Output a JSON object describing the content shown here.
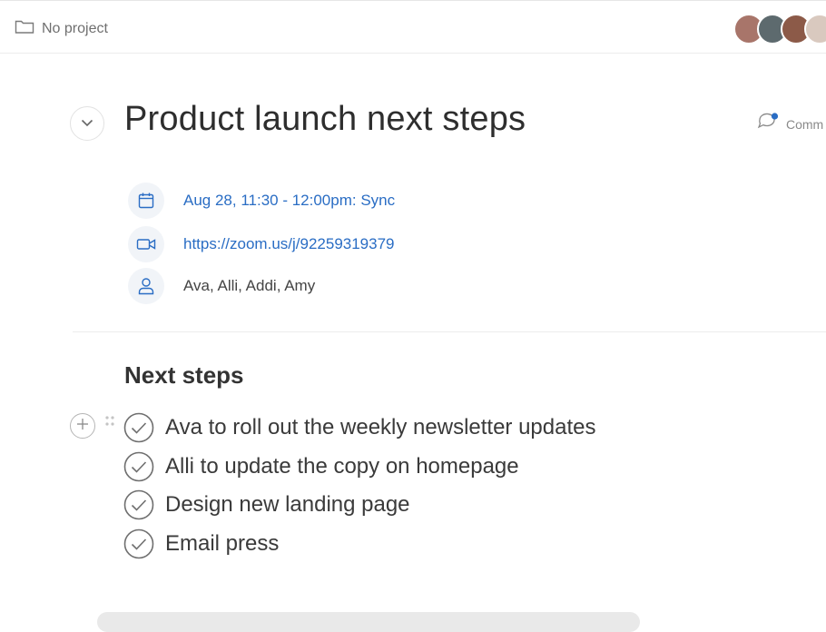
{
  "header": {
    "project_label": "No project",
    "project_icon": "folder-icon",
    "avatars": [
      {
        "name": "avatar-1",
        "color": "#a8756a"
      },
      {
        "name": "avatar-2",
        "color": "#5d6a6e"
      },
      {
        "name": "avatar-3",
        "color": "#8c5a48"
      },
      {
        "name": "avatar-4",
        "color": "#d9c9bf"
      },
      {
        "name": "avatar-5",
        "color": "#cfcfcf"
      }
    ]
  },
  "note": {
    "title": "Product launch next steps",
    "collapse_icon": "chevron-down-icon",
    "comment_label": "Comm",
    "comment_icon": "comment-icon"
  },
  "meeting": {
    "event": "Aug 28, 11:30 - 12:00pm: Sync",
    "event_icon": "calendar-icon",
    "link": "https://zoom.us/j/92259319379",
    "link_icon": "video-icon",
    "attendees": "Ava, Alli, Addi, Amy",
    "attendees_icon": "person-icon"
  },
  "next_steps": {
    "heading": "Next steps",
    "tasks": [
      {
        "text": "Ava to roll out the weekly newsletter updates"
      },
      {
        "text": "Alli to update the copy on homepage"
      },
      {
        "text": "Design new landing page"
      },
      {
        "text": "Email press"
      }
    ]
  },
  "colors": {
    "link": "#2a6dc4",
    "accent_dot": "#2a6dc4",
    "icon_bg": "#f1f4f8",
    "check": "#6f6f6f"
  }
}
